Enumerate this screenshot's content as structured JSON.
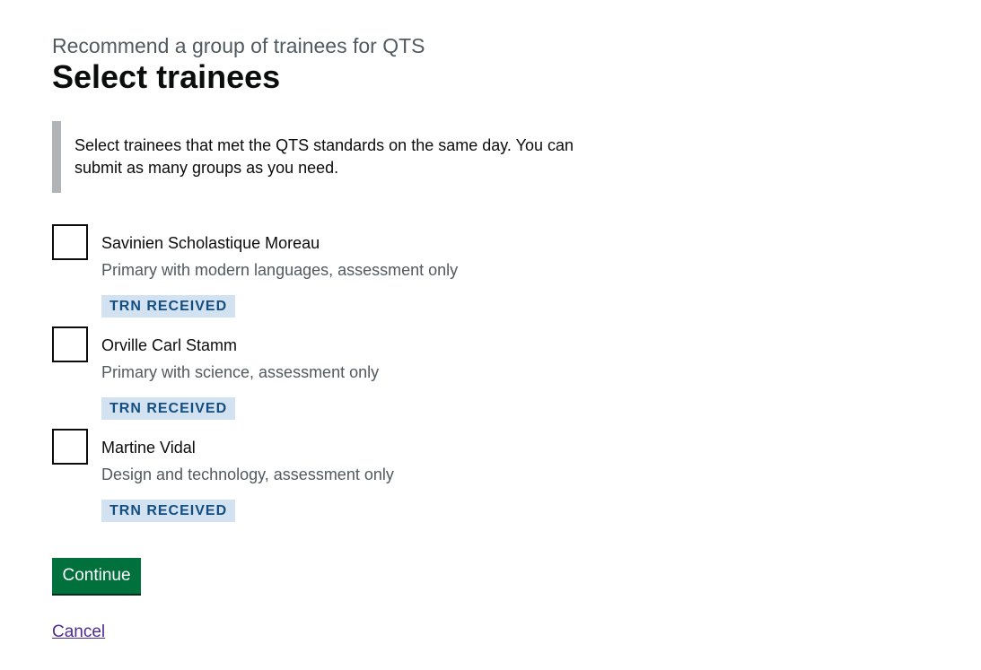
{
  "caption": "Recommend a group of trainees for QTS",
  "title": "Select trainees",
  "inset_text": "Select trainees that met the QTS standards on the same day. You can submit as many groups as you need.",
  "trainees": [
    {
      "name": "Savinien Scholastique Moreau",
      "course": "Primary with modern languages, assessment only",
      "status": "TRN RECEIVED",
      "checked": false
    },
    {
      "name": "Orville Carl Stamm",
      "course": "Primary with science, assessment only",
      "status": "TRN RECEIVED",
      "checked": false
    },
    {
      "name": "Martine Vidal",
      "course": "Design and technology, assessment only",
      "status": "TRN RECEIVED",
      "checked": false
    }
  ],
  "continue_label": "Continue",
  "cancel_label": "Cancel",
  "colors": {
    "button": "#00703c",
    "tag_bg": "#d2e2f1",
    "tag_text": "#144e81",
    "link": "#4c2c92",
    "inset_border": "#b1b4b6"
  }
}
